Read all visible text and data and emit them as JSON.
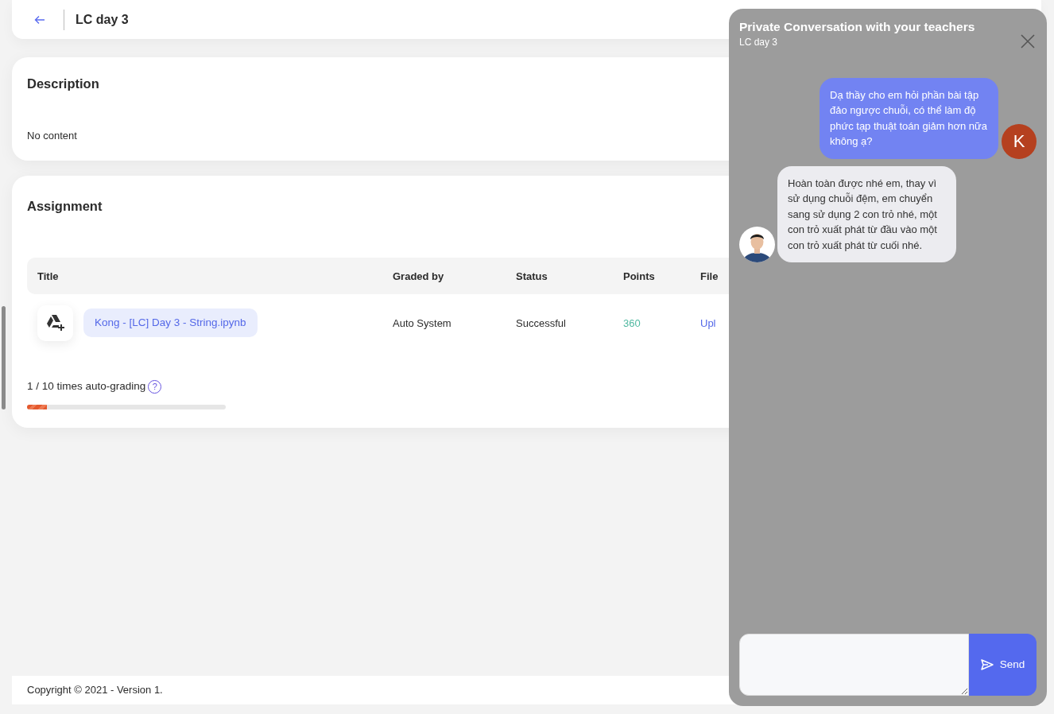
{
  "header": {
    "title": "LC day 3"
  },
  "description": {
    "heading": "Description",
    "body": "No content"
  },
  "assignment": {
    "heading": "Assignment",
    "table": {
      "columns": [
        "Title",
        "Graded by",
        "Status",
        "Points",
        "File"
      ],
      "rows": [
        {
          "title": "Kong - [LC] Day 3 - String.ipynb",
          "graded_by": "Auto System",
          "status": "Successful",
          "points": "360",
          "file": "Upl"
        }
      ]
    },
    "auto_grading": {
      "text": "1 / 10 times auto-grading",
      "help": "?",
      "level": 0.1
    }
  },
  "footer": "Copyright © 2021 - Version 1.",
  "chat": {
    "title": "Private Conversation with your teachers",
    "subtitle": "LC day 3",
    "messages": [
      {
        "kind": "sent",
        "avatar": "K",
        "text": "Dạ thầy cho em hỏi phần bài tập đảo ngược chuỗi, có thể làm độ phức tạp thuật toán giảm hơn nữa không ạ?"
      },
      {
        "kind": "received",
        "text": "Hoàn toàn được nhé em, thay vì sử dụng chuỗi đệm, em chuyển sang sử dụng 2 con trỏ nhé, một con trỏ xuất phát từ đầu vào một con trỏ xuất phát từ cuối nhé."
      }
    ],
    "send_label": "Send"
  }
}
